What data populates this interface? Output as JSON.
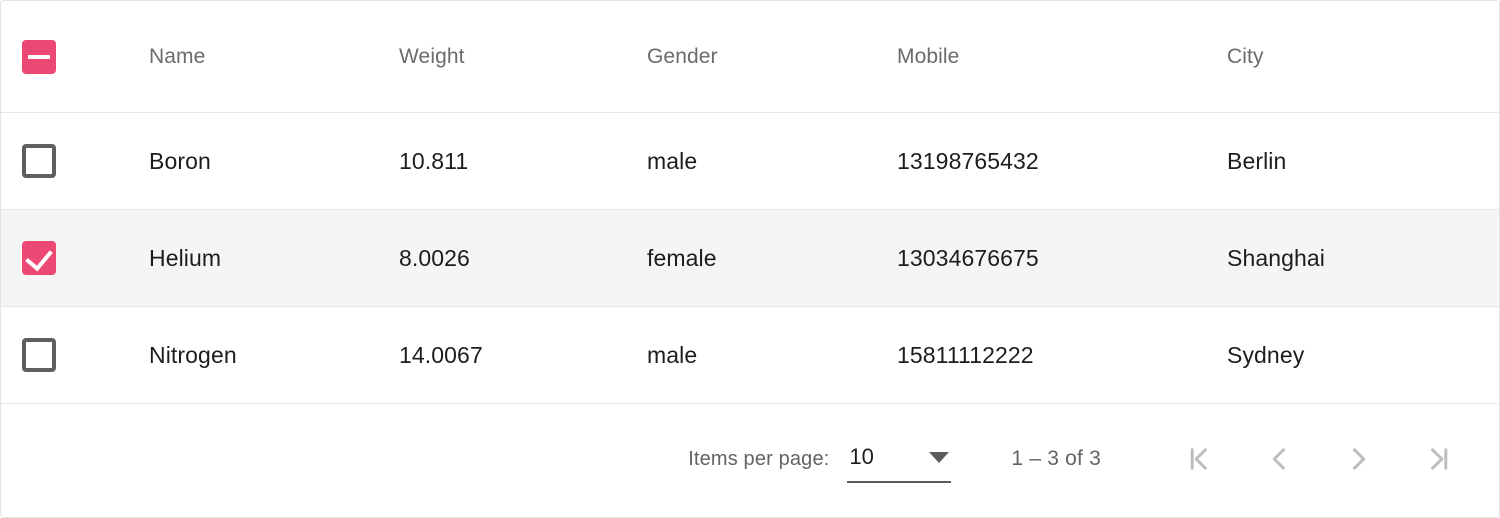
{
  "table": {
    "select_all_checkbox": {
      "state": "indeterminate",
      "label": "Select all rows"
    },
    "columns": [
      {
        "key": "name",
        "label": "Name"
      },
      {
        "key": "weight",
        "label": "Weight"
      },
      {
        "key": "gender",
        "label": "Gender"
      },
      {
        "key": "mobile",
        "label": "Mobile"
      },
      {
        "key": "city",
        "label": "City"
      }
    ],
    "rows": [
      {
        "selected": false,
        "name": "Boron",
        "weight": "10.811",
        "gender": "male",
        "mobile": "13198765432",
        "city": "Berlin"
      },
      {
        "selected": true,
        "name": "Helium",
        "weight": "8.0026",
        "gender": "female",
        "mobile": "13034676675",
        "city": "Shanghai"
      },
      {
        "selected": false,
        "name": "Nitrogen",
        "weight": "14.0067",
        "gender": "male",
        "mobile": "15811112222",
        "city": "Sydney"
      }
    ]
  },
  "paginator": {
    "items_per_page_label": "Items per page:",
    "items_per_page_value": "10",
    "items_per_page_options": [
      "10"
    ],
    "range_label": "1 – 3 of 3",
    "buttons": {
      "first_page": "First page",
      "previous_page": "Previous page",
      "next_page": "Next page",
      "last_page": "Last page"
    },
    "buttons_disabled": true
  },
  "colors": {
    "accent_pink": "#ec4874",
    "selected_row_bg": "#f5f5f5",
    "border": "#e6e6e6",
    "header_text": "#6b6b6b",
    "body_text": "#1d1d1d",
    "disabled_icon": "#bdbdbd"
  }
}
